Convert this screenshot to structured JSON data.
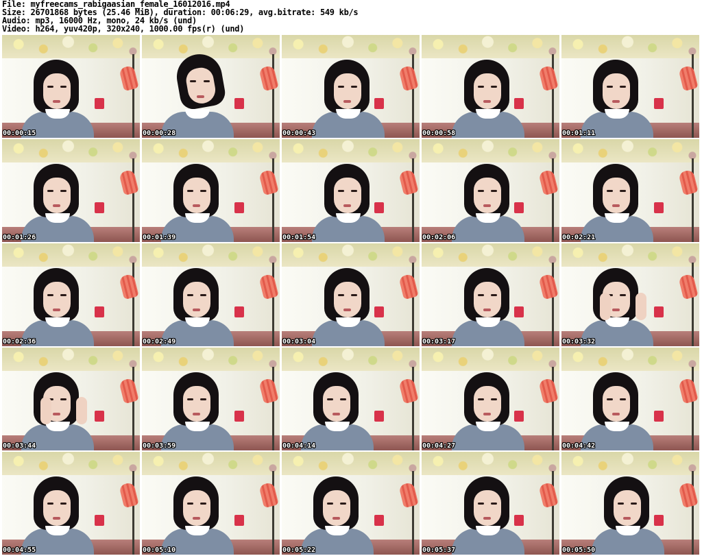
{
  "header": {
    "file_line": "File: myfreecams_rabigaasian_female_16012016.mp4",
    "size_line": "Size: 26701868 bytes (25.46 MiB), duration: 00:06:29, avg.bitrate: 549 kb/s",
    "audio_line": "Audio: mp3, 16000 Hz, mono, 24 kb/s (und)",
    "video_line": "Video: h264, yuv420p, 320x240, 1000.00 fps(r) (und)"
  },
  "thumbnails": [
    {
      "timestamp": "00:00:15",
      "pose": "v-base"
    },
    {
      "timestamp": "00:00:28",
      "pose": "v-tilt"
    },
    {
      "timestamp": "00:00:43",
      "pose": "v-right"
    },
    {
      "timestamp": "00:00:58",
      "pose": "v-right"
    },
    {
      "timestamp": "00:01:11",
      "pose": "v-base"
    },
    {
      "timestamp": "00:01:26",
      "pose": "v-base"
    },
    {
      "timestamp": "00:01:39",
      "pose": "v-base"
    },
    {
      "timestamp": "00:01:54",
      "pose": "v-right"
    },
    {
      "timestamp": "00:02:06",
      "pose": "v-right"
    },
    {
      "timestamp": "00:02:21",
      "pose": "v-base"
    },
    {
      "timestamp": "00:02:36",
      "pose": "v-base"
    },
    {
      "timestamp": "00:02:49",
      "pose": "v-base"
    },
    {
      "timestamp": "00:03:04",
      "pose": "v-right"
    },
    {
      "timestamp": "00:03:17",
      "pose": "v-right"
    },
    {
      "timestamp": "00:03:32",
      "pose": "v-hands"
    },
    {
      "timestamp": "00:03:44",
      "pose": "v-hands"
    },
    {
      "timestamp": "00:03:59",
      "pose": "v-base"
    },
    {
      "timestamp": "00:04:14",
      "pose": "v-base"
    },
    {
      "timestamp": "00:04:27",
      "pose": "v-right"
    },
    {
      "timestamp": "00:04:42",
      "pose": "v-base"
    },
    {
      "timestamp": "00:04:55",
      "pose": "v-base"
    },
    {
      "timestamp": "00:05:10",
      "pose": "v-base"
    },
    {
      "timestamp": "00:05:22",
      "pose": "v-base"
    },
    {
      "timestamp": "00:05:37",
      "pose": "v-right"
    },
    {
      "timestamp": "00:05:50",
      "pose": "v-right"
    }
  ]
}
